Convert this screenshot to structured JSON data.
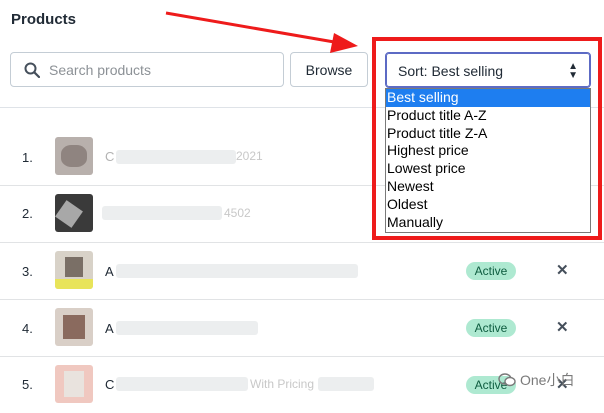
{
  "page": {
    "title": "Products",
    "search_placeholder": "Search products",
    "browse_label": "Browse"
  },
  "sort": {
    "label": "Sort: Best selling",
    "options": [
      "Best selling",
      "Product title A-Z",
      "Product title Z-A",
      "Highest price",
      "Lowest price",
      "Newest",
      "Oldest",
      "Manually"
    ],
    "selected": "Best selling"
  },
  "rows": [
    {
      "index": "1.",
      "title_fragment": "C",
      "title_suffix": "2021",
      "status": ""
    },
    {
      "index": "2.",
      "title_fragment": "",
      "title_suffix": "4502",
      "status": ""
    },
    {
      "index": "3.",
      "title_fragment": "A",
      "title_suffix": "",
      "status": "Active"
    },
    {
      "index": "4.",
      "title_fragment": "A",
      "title_suffix": "",
      "status": "Active"
    },
    {
      "index": "5.",
      "title_fragment": "C",
      "title_suffix": "With Pricing",
      "status": "Active"
    }
  ],
  "watermark": "One小白",
  "colors": {
    "highlight_red": "#ee1b1b",
    "active_badge": "#aee9d1",
    "selected_option": "#1e7ef0"
  },
  "icons": {
    "search": "search-icon",
    "remove": "close-icon",
    "sort": "sort-caret-icon",
    "watermark": "wechat-icon"
  }
}
